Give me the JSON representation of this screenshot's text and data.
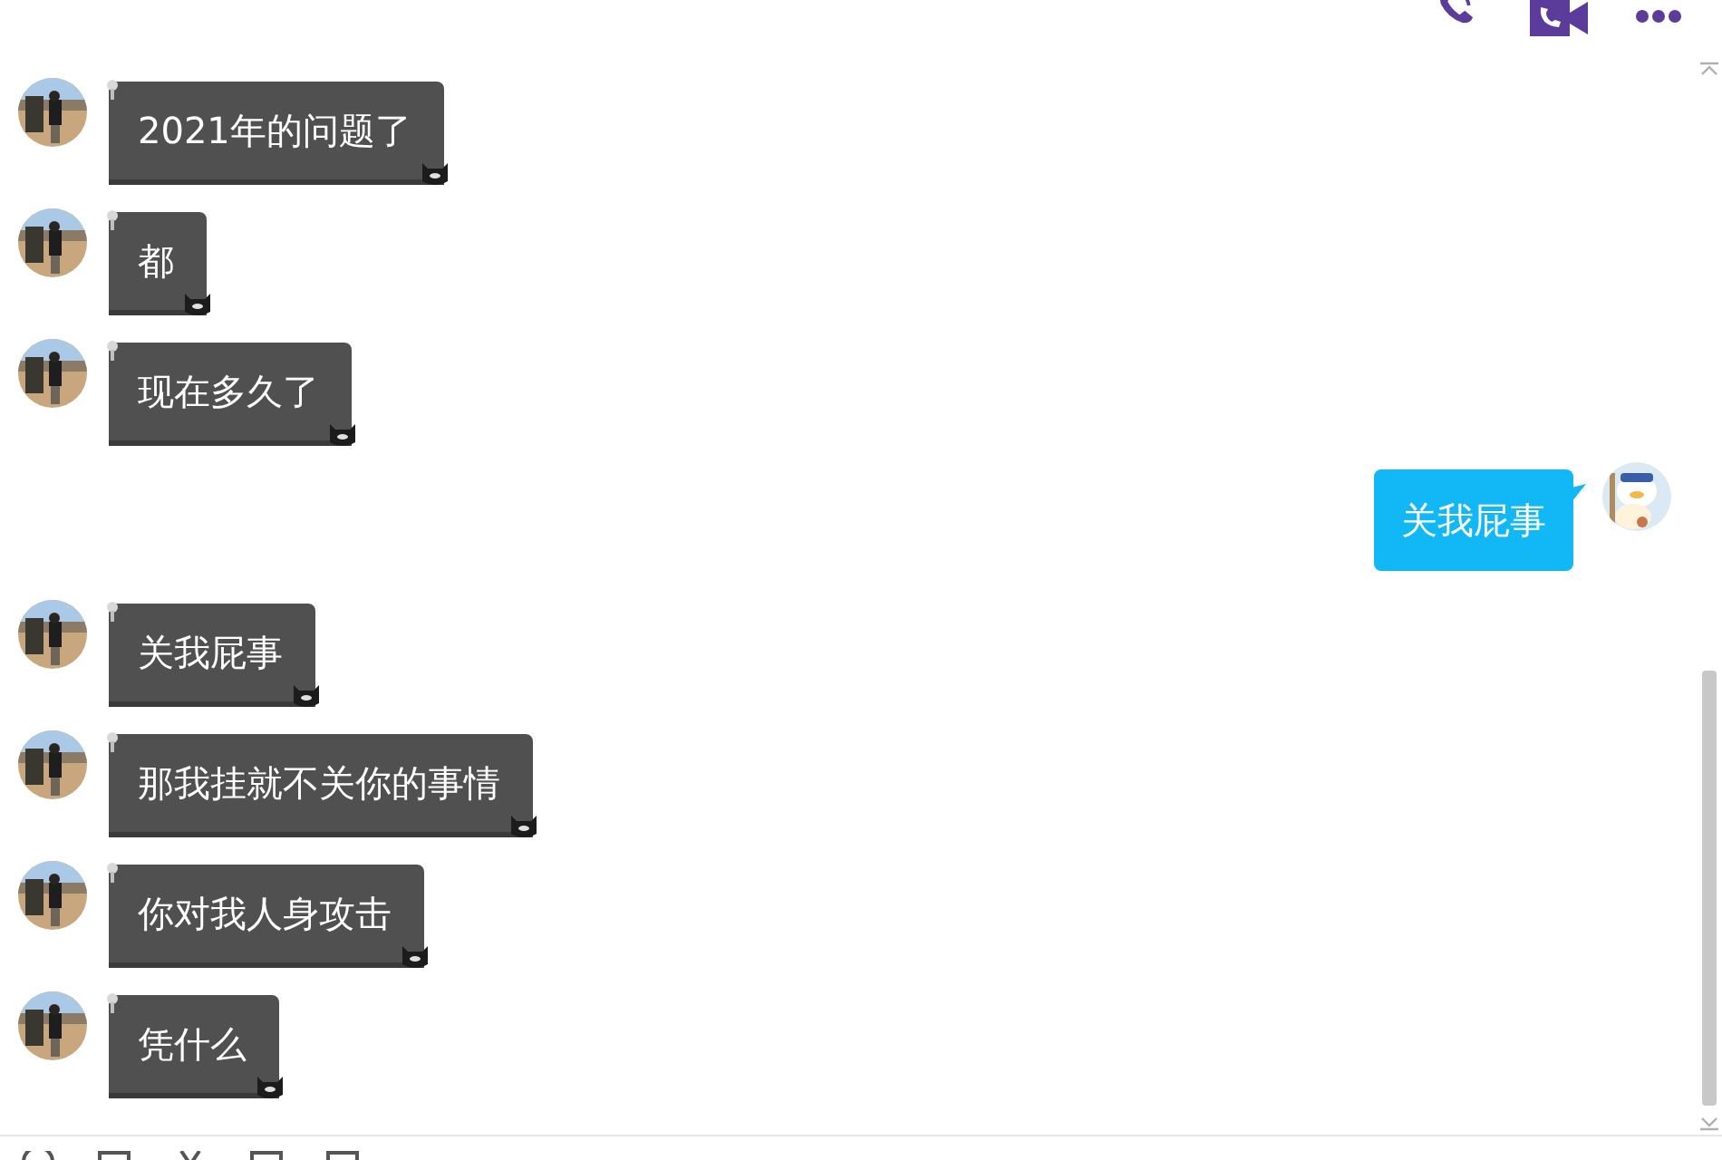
{
  "messages": [
    {
      "kind": "incoming",
      "text": "2021年的问题了"
    },
    {
      "kind": "incoming",
      "text": "都"
    },
    {
      "kind": "incoming",
      "text": "现在多久了"
    },
    {
      "kind": "outgoing",
      "text": "关我屁事"
    },
    {
      "kind": "incoming",
      "text": "关我屁事"
    },
    {
      "kind": "incoming",
      "text": "那我挂就不关你的事情"
    },
    {
      "kind": "incoming",
      "text": "你对我人身攻击"
    },
    {
      "kind": "incoming",
      "text": "凭什么"
    }
  ]
}
